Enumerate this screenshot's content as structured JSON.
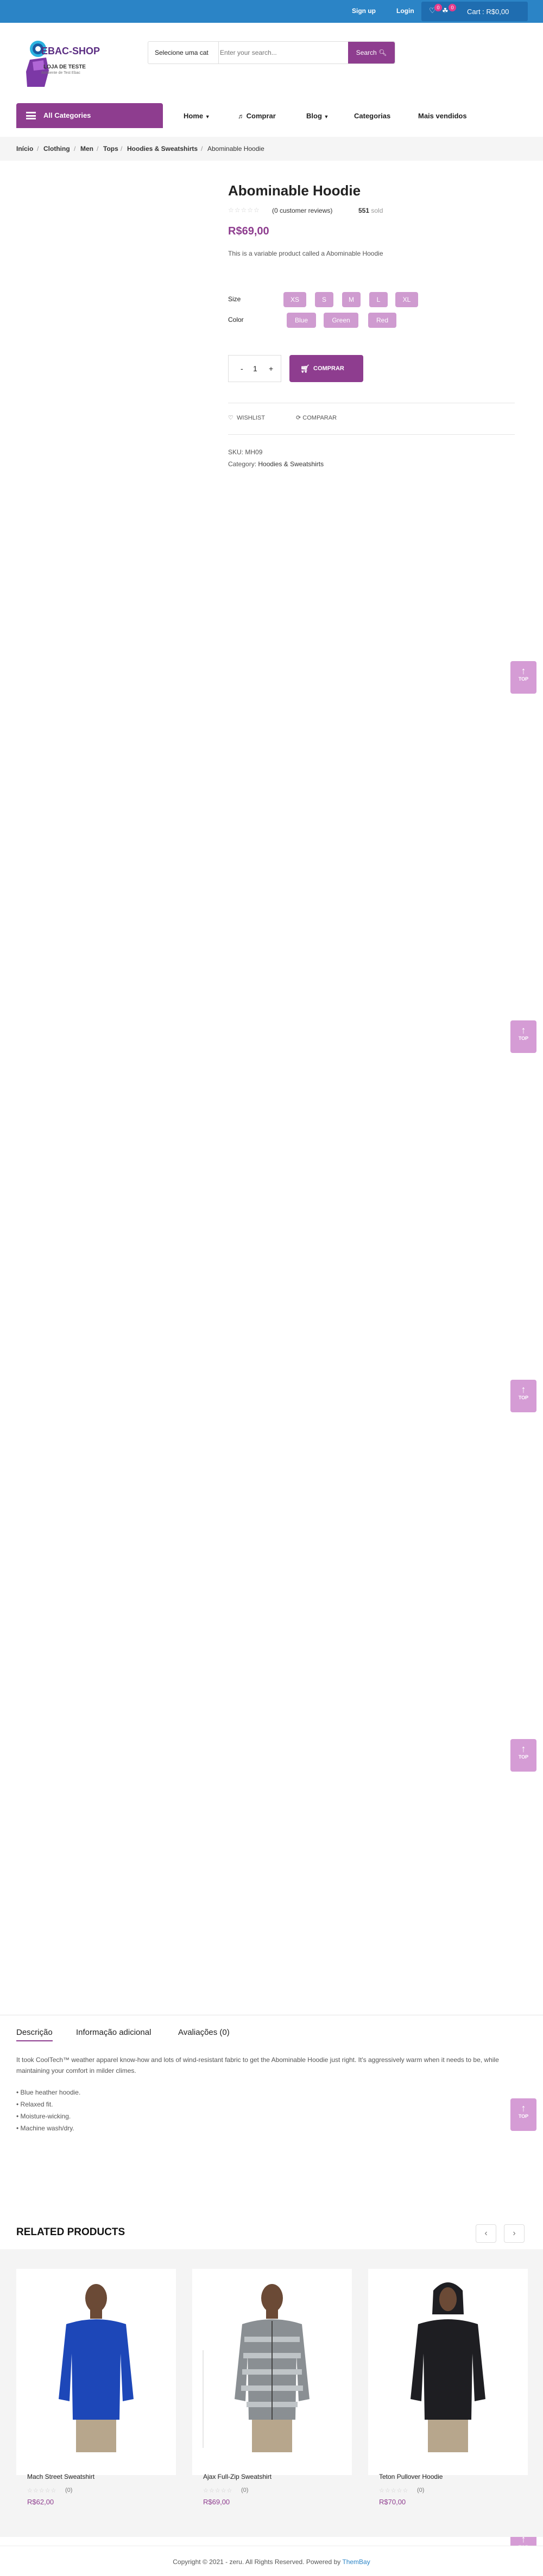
{
  "topbar": {
    "signup_label": "Sign up",
    "login_label": "Login",
    "wishlist_count": "0",
    "cart_count": "0",
    "cart_label": "Cart : R$0,00",
    "background": "#2b84c6"
  },
  "header": {
    "logo_title": "EBAC-SHOP",
    "logo_subtitle": "LOJA DE TESTE",
    "logo_tagline": "Ambiente de Test Ebac",
    "search": {
      "category_label": "Selecione uma cat",
      "placeholder": "Enter your search...",
      "button_label": "Search"
    }
  },
  "nav": {
    "all_categories_label": "All Categories",
    "items": [
      {
        "label": "Home",
        "has_dropdown": true
      },
      {
        "label": "Comprar",
        "icon": "headset-icon"
      },
      {
        "label": "Blog",
        "has_dropdown": true
      },
      {
        "label": "Categorias"
      },
      {
        "label": "Mais vendidos"
      }
    ]
  },
  "breadcrumb": [
    "Início",
    "Clothing",
    "Men",
    "Tops",
    "Hoodies & Sweatshirts",
    "Abominable Hoodie"
  ],
  "product": {
    "title": "Abominable Hoodie",
    "reviews_label": "(0 customer reviews)",
    "sold_count": "551",
    "sold_label": "sold",
    "price": "R$69,00",
    "short_description": "This is a variable product called a Abominable Hoodie",
    "size_label": "Size",
    "sizes": [
      "XS",
      "S",
      "M",
      "L",
      "XL"
    ],
    "color_label": "Color",
    "colors": [
      "Blue",
      "Green",
      "Red"
    ],
    "quantity": "1",
    "add_to_cart_label": "COMPRAR",
    "wishlist_label": "WISHLIST",
    "compare_label": "COMPARAR",
    "sku_label": "SKU:",
    "sku_value": "MH09",
    "category_label": "Category:",
    "category_value": "Hoodies & Sweatshirts"
  },
  "to_top_label": "TOP",
  "tabs": {
    "items": [
      "Descrição",
      "Informação adicional",
      "Avaliações (0)"
    ],
    "description": "It took CoolTech™ weather apparel know-how and lots of wind-resistant fabric to get the Abominable Hoodie just right. It's aggressively warm when it needs to be, while maintaining your comfort in milder climes.",
    "bullets": [
      "• Blue heather hoodie.",
      "• Relaxed fit.",
      "• Moisture-wicking.",
      "• Machine wash/dry."
    ]
  },
  "related": {
    "title": "RELATED PRODUCTS",
    "products": [
      {
        "name": "Mach Street Sweatshirt",
        "rating": "(0)",
        "price": "R$62,00",
        "garment_color": "#1d47b8"
      },
      {
        "name": "Ajax Full-Zip Sweatshirt",
        "rating": "(0)",
        "price": "R$69,00",
        "garment_color": "#8a8f93"
      },
      {
        "name": "Teton Pullover Hoodie",
        "rating": "(0)",
        "price": "R$70,00",
        "garment_color": "#1e1e22"
      }
    ]
  },
  "footer": {
    "copyright": "Copyright © 2021 - zeru. All Rights Reserved. Powered by",
    "powered_by": "ThemBay"
  },
  "colors": {
    "accent": "#8e3d8f",
    "swatch": "#cf9bd0",
    "to_top": "#d59cd5"
  }
}
